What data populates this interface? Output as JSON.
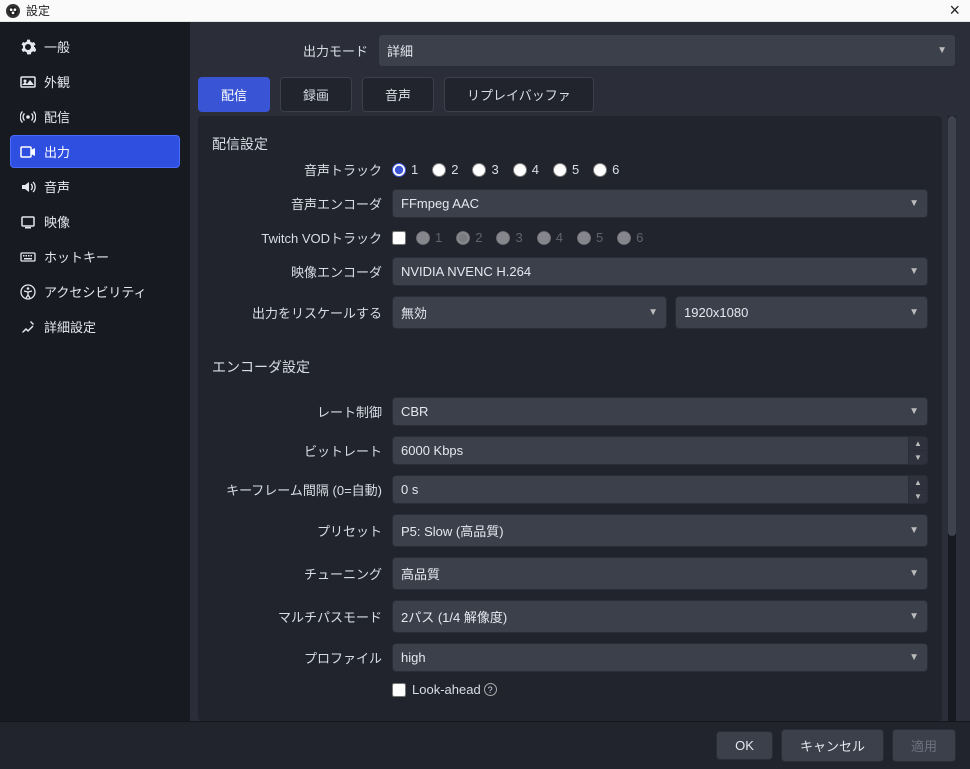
{
  "title": "設定",
  "sidebar": [
    {
      "icon": "gear",
      "label": "一般"
    },
    {
      "icon": "appearance",
      "label": "外観"
    },
    {
      "icon": "stream",
      "label": "配信"
    },
    {
      "icon": "output",
      "label": "出力",
      "active": true
    },
    {
      "icon": "audio",
      "label": "音声"
    },
    {
      "icon": "video",
      "label": "映像"
    },
    {
      "icon": "hotkey",
      "label": "ホットキー"
    },
    {
      "icon": "accessibility",
      "label": "アクセシビリティ"
    },
    {
      "icon": "advanced",
      "label": "詳細設定"
    }
  ],
  "output_mode": {
    "label": "出力モード",
    "value": "詳細"
  },
  "tabs": [
    "配信",
    "録画",
    "音声",
    "リプレイバッファ"
  ],
  "active_tab": 0,
  "streaming": {
    "title": "配信設定",
    "audio_track": {
      "label": "音声トラック",
      "options": [
        "1",
        "2",
        "3",
        "4",
        "5",
        "6"
      ],
      "selected": 0
    },
    "audio_encoder": {
      "label": "音声エンコーダ",
      "value": "FFmpeg AAC"
    },
    "twitch_vod": {
      "label": "Twitch VODトラック",
      "checked": false,
      "options": [
        "1",
        "2",
        "3",
        "4",
        "5",
        "6"
      ],
      "selected": 1
    },
    "video_encoder": {
      "label": "映像エンコーダ",
      "value": "NVIDIA NVENC H.264"
    },
    "rescale": {
      "label": "出力をリスケールする",
      "value": "無効",
      "resolution": "1920x1080"
    }
  },
  "encoder": {
    "title": "エンコーダ設定",
    "rate_control": {
      "label": "レート制御",
      "value": "CBR"
    },
    "bitrate": {
      "label": "ビットレート",
      "value": "6000 Kbps"
    },
    "keyframe": {
      "label": "キーフレーム間隔 (0=自動)",
      "value": "0 s"
    },
    "preset": {
      "label": "プリセット",
      "value": "P5: Slow (高品質)"
    },
    "tuning": {
      "label": "チューニング",
      "value": "高品質"
    },
    "multipass": {
      "label": "マルチパスモード",
      "value": "2パス (1/4 解像度)"
    },
    "profile": {
      "label": "プロファイル",
      "value": "high"
    },
    "lookahead": {
      "label": "Look-ahead",
      "checked": false
    }
  },
  "footer": {
    "ok": "OK",
    "cancel": "キャンセル",
    "apply": "適用"
  }
}
